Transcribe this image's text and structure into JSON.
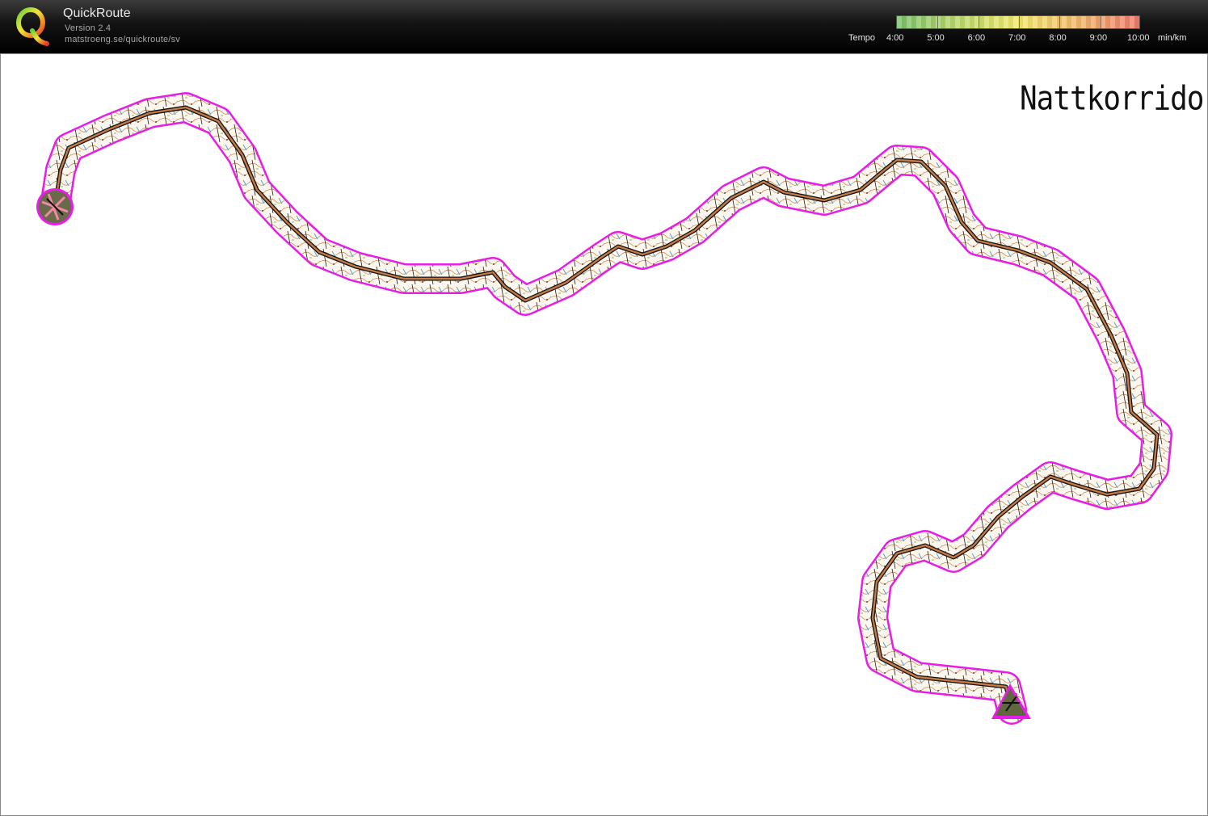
{
  "app": {
    "name": "QuickRoute",
    "version": "Version 2.4",
    "url": "matstroeng.se/quickroute/sv"
  },
  "pace_scale": {
    "label": "Tempo",
    "ticks": [
      "4:00",
      "5:00",
      "6:00",
      "7:00",
      "8:00",
      "9:00",
      "10:00"
    ],
    "unit": "min/km",
    "colors": [
      "#7cc06c",
      "#b9d96b",
      "#f3ea6d",
      "#f0b86b",
      "#ef7a6c"
    ]
  },
  "map": {
    "title": "Nattkorridor",
    "corridor_color": "#e61ee6",
    "route_color": "#6b1a12",
    "start_symbol": "start-circle",
    "finish_symbol": "finish-triangle"
  }
}
